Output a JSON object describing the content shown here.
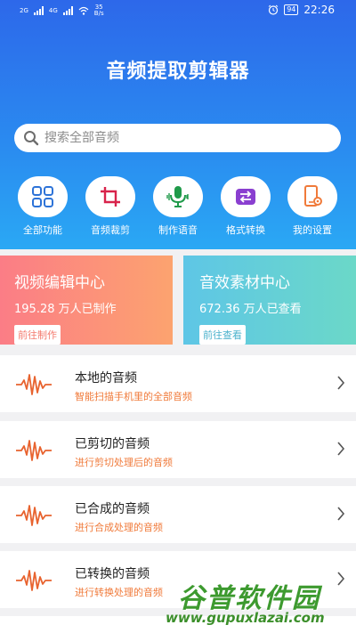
{
  "status_bar": {
    "net1": "2G",
    "net2": "4G",
    "speed_value": "35",
    "speed_unit": "B/s",
    "battery": "94",
    "time": "22:26"
  },
  "app": {
    "title": "音频提取剪辑器"
  },
  "search": {
    "placeholder": "搜索全部音频"
  },
  "quick_actions": [
    {
      "label": "全部功能",
      "icon": "grid-icon"
    },
    {
      "label": "音频裁剪",
      "icon": "crop-icon"
    },
    {
      "label": "制作语音",
      "icon": "microphone-icon"
    },
    {
      "label": "格式转换",
      "icon": "convert-icon"
    },
    {
      "label": "我的设置",
      "icon": "phone-settings-icon"
    }
  ],
  "cards": {
    "video": {
      "title": "视频编辑中心",
      "stat": "195.28 万人已制作",
      "button": "前往制作",
      "color_start": "#fb7d86",
      "color_end": "#fca36f"
    },
    "effects": {
      "title": "音效素材中心",
      "stat": "672.36 万人已查看",
      "button": "前往查看",
      "color_start": "#5ec6e6",
      "color_end": "#6bd8c8"
    }
  },
  "list": [
    {
      "title": "本地的音频",
      "subtitle": "智能扫描手机里的全部音频"
    },
    {
      "title": "已剪切的音频",
      "subtitle": "进行剪切处理后的音频"
    },
    {
      "title": "已合成的音频",
      "subtitle": "进行合成处理的音频"
    },
    {
      "title": "已转换的音频",
      "subtitle": "进行转换处理的音频"
    }
  ],
  "watermark": {
    "name": "谷普软件园",
    "url": "www.gupuxlazai.com"
  },
  "colors": {
    "accent": "#2d7cf0",
    "subtitle": "#f07a3a",
    "waveform": "#e8632f"
  }
}
